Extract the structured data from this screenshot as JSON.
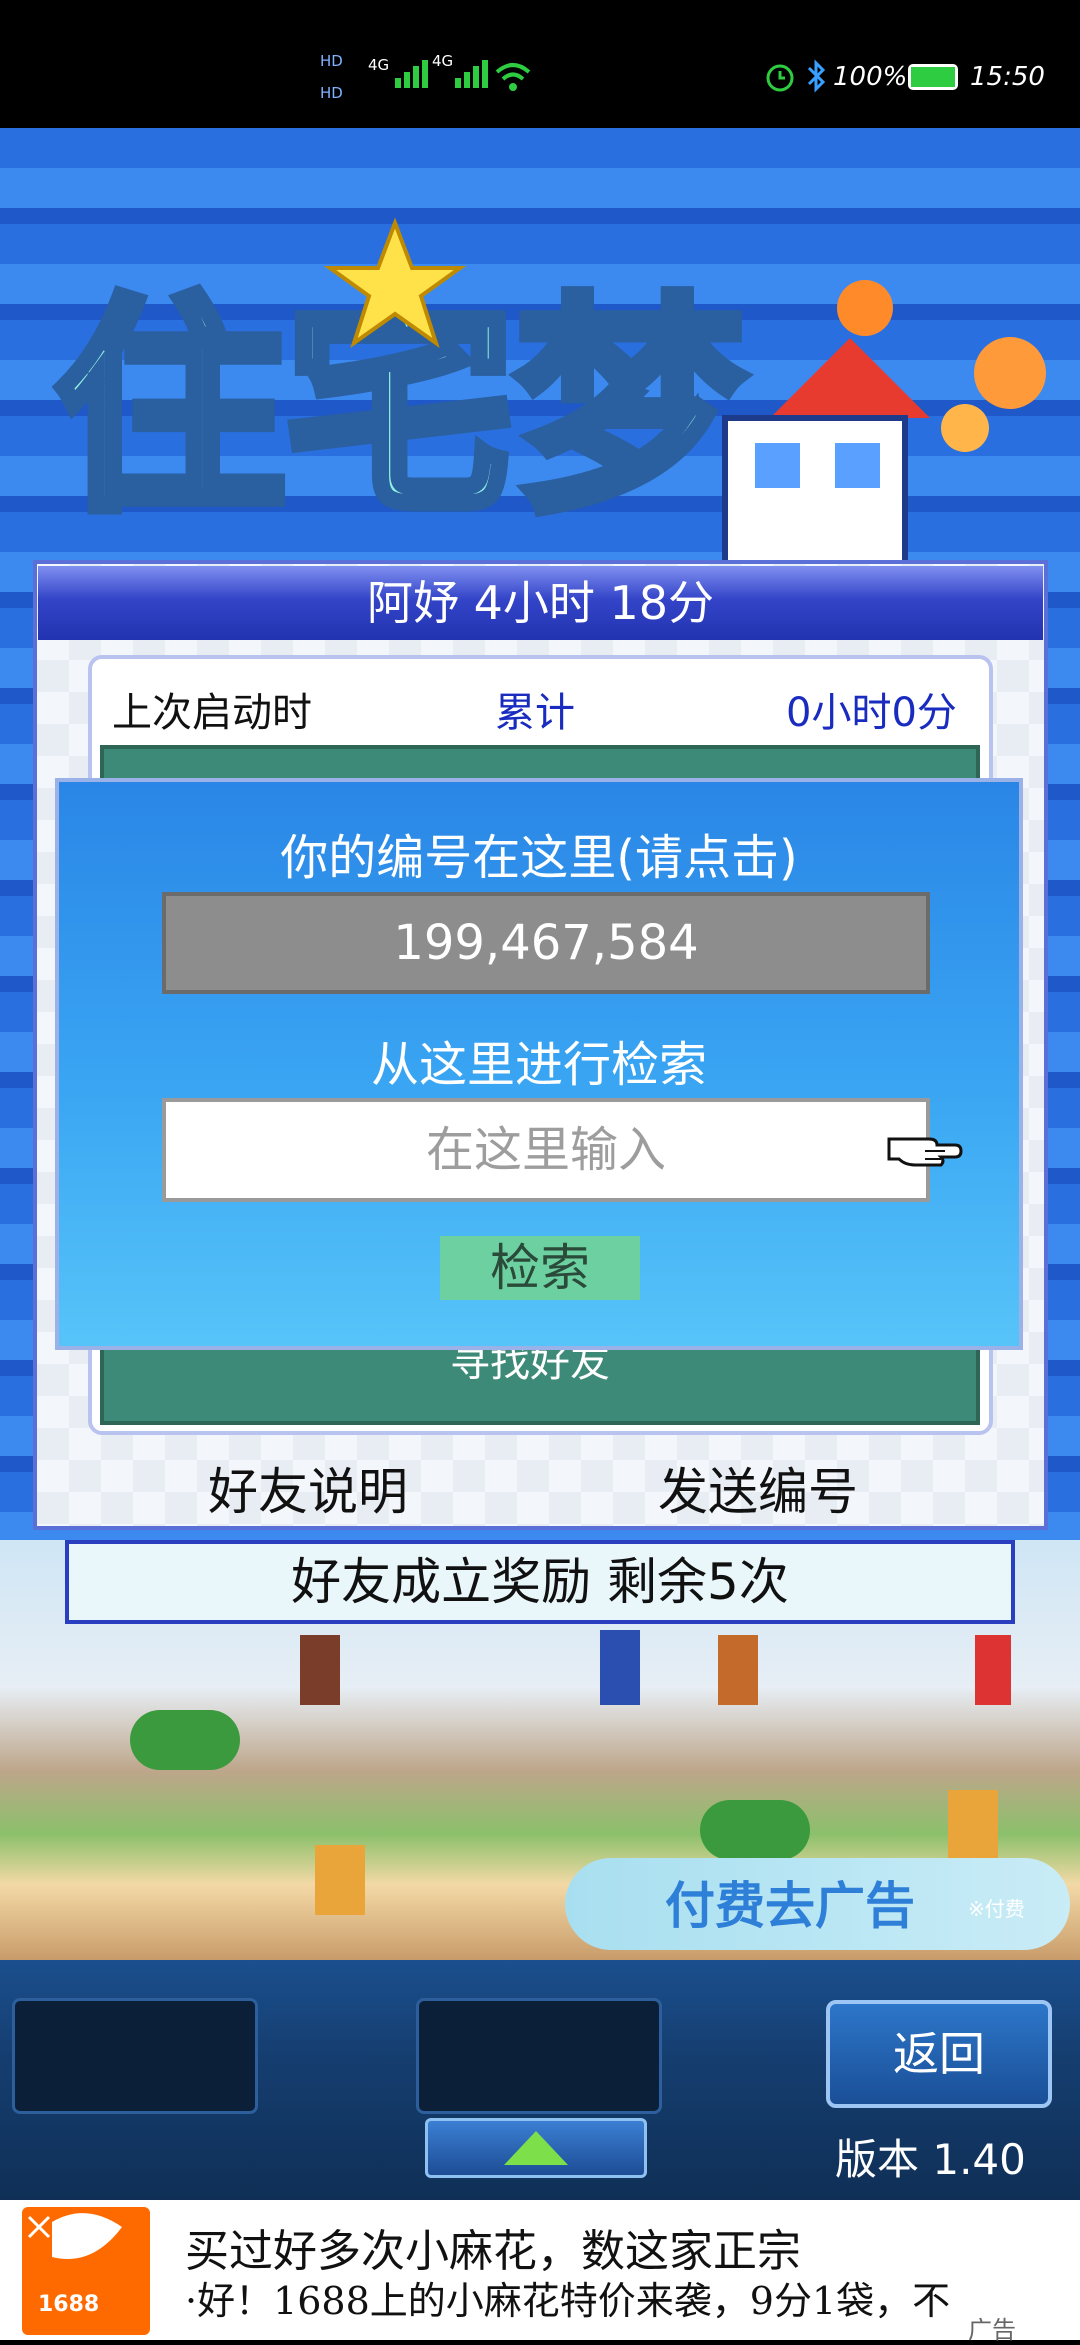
{
  "status_bar": {
    "hd1": "HD",
    "hd2": "HD",
    "net1": "4G",
    "net2": "4G",
    "battery": "100%",
    "time": "15:50"
  },
  "panel": {
    "header": "阿妤  4小时 18分",
    "last_launch_label": "上次启动时",
    "cumulative_label": "累计",
    "cumulative_value": "0小时0分",
    "find_friend_label": "寻找好友",
    "friend_explain_button": "好友说明",
    "send_id_button": "发送编号"
  },
  "search_dialog": {
    "id_prompt": "你的编号在这里(请点击)",
    "id_value": "199,467,584",
    "search_prompt": "从这里进行检索",
    "input_placeholder": "在这里输入",
    "search_button": "检索"
  },
  "reward_bar": "好友成立奖励  剩余5次",
  "paid_ad": {
    "label": "付费去广告",
    "note": "※付费"
  },
  "back_button": "返回",
  "version": "版本 1.40",
  "ad_banner": {
    "logo_text": "1688",
    "line1": "买过好多次小麻花，数这家正宗",
    "line2": "·好！1688上的小麻花特价来袭，9分1袋，不",
    "tag": "广告"
  },
  "colors": {
    "header_blue": "#2233b0",
    "dialog_blue": "#3aa6f3",
    "input_grey": "#8d8d8d",
    "search_green": "#6dd0a0"
  }
}
